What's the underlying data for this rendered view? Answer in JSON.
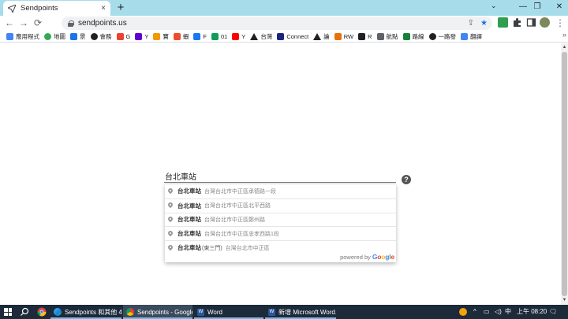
{
  "browser": {
    "tab": {
      "title": "Sendpoints",
      "close": "×"
    },
    "new_tab": "+",
    "window_controls": {
      "minimize": "—",
      "maximize": "❐",
      "close": "✕",
      "tab_search": "⌄"
    },
    "nav": {
      "back": "←",
      "forward": "→",
      "reload": "⟳"
    },
    "url": "sendpoints.us",
    "omnibox_icons": {
      "share": "⇪",
      "star": "★"
    }
  },
  "bookmarks": [
    {
      "label": "應用程式",
      "icon": "apps-grid-icon",
      "color": "#4285f4"
    },
    {
      "label": "地圖",
      "icon": "maps-pin-icon",
      "color": "#34a853"
    },
    {
      "label": "景",
      "icon": "cloud-icon",
      "color": "#1a73e8"
    },
    {
      "label": "會務",
      "icon": "globe-icon",
      "color": "#202124"
    },
    {
      "label": "G",
      "icon": "gmail-icon",
      "color": "#ea4335"
    },
    {
      "label": "Y",
      "icon": "yahoo-icon",
      "color": "#6001d2"
    },
    {
      "label": "寶",
      "icon": "diamond-icon",
      "color": "#f29900"
    },
    {
      "label": "蝦",
      "icon": "shopee-icon",
      "color": "#ee4d2d"
    },
    {
      "label": "F",
      "icon": "facebook-icon",
      "color": "#1877f2"
    },
    {
      "label": "01",
      "icon": "sheet-icon",
      "color": "#0f9d58"
    },
    {
      "label": "Y",
      "icon": "youtube-icon",
      "color": "#ff0000"
    },
    {
      "label": "台灣",
      "icon": "triangle-icon",
      "color": "#202124"
    },
    {
      "label": "Connect",
      "icon": "connect-icon",
      "color": "#1a237e"
    },
    {
      "label": "論",
      "icon": "triangle-icon",
      "color": "#202124"
    },
    {
      "label": "RW",
      "icon": "bike-icon",
      "color": "#e8710a"
    },
    {
      "label": "R",
      "icon": "r-icon",
      "color": "#202124"
    },
    {
      "label": "航點",
      "icon": "plane-icon",
      "color": "#5f6368"
    },
    {
      "label": "路線",
      "icon": "route-icon",
      "color": "#188038"
    },
    {
      "label": "一路發",
      "icon": "globe-icon",
      "color": "#202124"
    },
    {
      "label": "翻譯",
      "icon": "translate-icon",
      "color": "#4285f4"
    }
  ],
  "bookmarks_more": "»",
  "search": {
    "value": "台北車站",
    "help": "?"
  },
  "suggestions": [
    {
      "main": "台北車站",
      "sub": "台灣台北市中正區承德路一段"
    },
    {
      "main": "台北車站",
      "sub": "台灣台北市中正區北平西路"
    },
    {
      "main": "台北車站",
      "sub": "台灣台北市中正區鄭州路"
    },
    {
      "main": "台北車站",
      "sub": "台灣台北市中正區忠孝西路1段"
    },
    {
      "main": "台北車站",
      "main_extra": "(東三門)",
      "sub": "台灣台北市中正區"
    }
  ],
  "powered_by": {
    "prefix": "powered by",
    "logo": "Google"
  },
  "colors": {
    "tab_strip": "#a7dcea",
    "taskbar": "#1c2a3a",
    "google_blue": "#4285f4",
    "google_red": "#ea4335",
    "google_yellow": "#fbbc05",
    "google_green": "#34a853"
  },
  "taskbar": {
    "apps": [
      {
        "label": "Sendpoints 和其他 4 ...",
        "icon": "edge-icon"
      },
      {
        "label": "Sendpoints - Google...",
        "icon": "chrome-icon"
      },
      {
        "label": "Word",
        "icon": "word-icon"
      },
      {
        "label": "新增 Microsoft Word...",
        "icon": "word-icon"
      }
    ],
    "tray": {
      "ime": "中",
      "time": "上午 08:20",
      "notifications": "🗨"
    }
  }
}
